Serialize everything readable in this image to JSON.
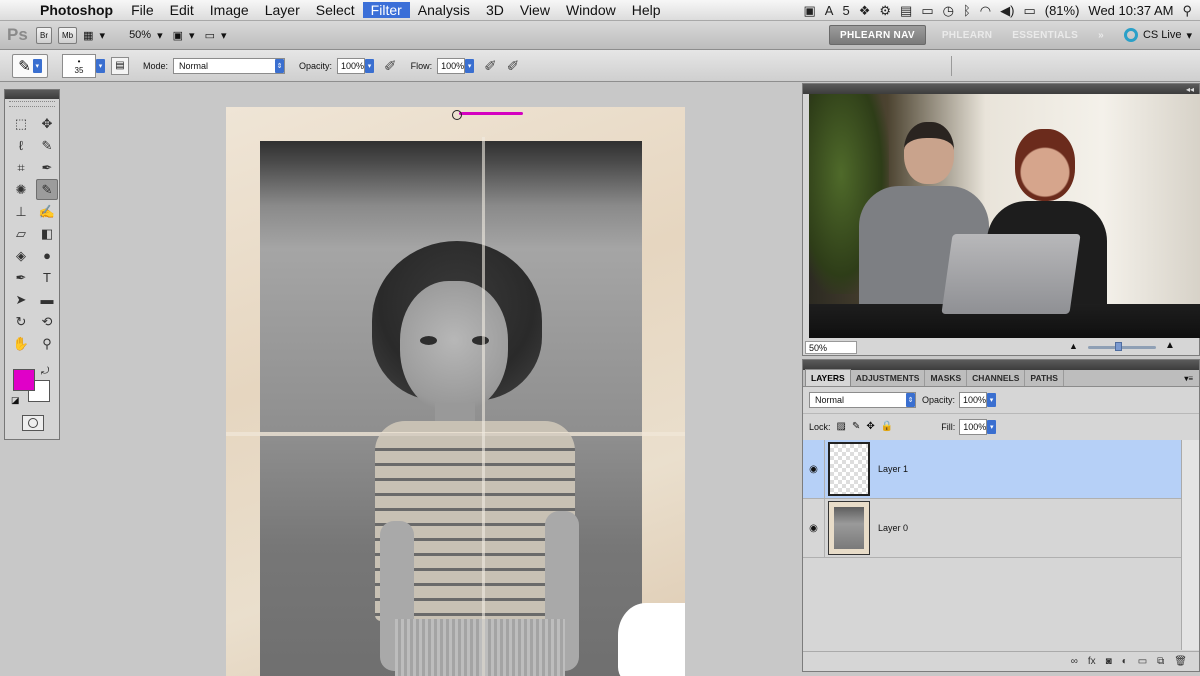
{
  "menubar": {
    "app_name": "Photoshop",
    "items": [
      "File",
      "Edit",
      "Image",
      "Layer",
      "Select",
      "Filter",
      "Analysis",
      "3D",
      "View",
      "Window",
      "Help"
    ],
    "active_item": "Filter",
    "status": {
      "adobe_count": "5",
      "battery": "(81%)",
      "clock": "Wed 10:37 AM"
    }
  },
  "appbar": {
    "logo": "Ps",
    "bridge": "Br",
    "mini_bridge": "Mb",
    "zoom": "50%",
    "workspaces": [
      "PHLEARN NAV",
      "PHLEARN",
      "ESSENTIALS"
    ],
    "active_workspace": "PHLEARN NAV",
    "cs_live": "CS Live"
  },
  "options": {
    "brush_size": "35",
    "mode_label": "Mode:",
    "mode_value": "Normal",
    "opacity_label": "Opacity:",
    "opacity_value": "100%",
    "flow_label": "Flow:",
    "flow_value": "100%"
  },
  "colors": {
    "foreground": "#e000c8",
    "background": "#ffffff",
    "selection": "#b6d0f7",
    "accent": "#3b6fd8"
  },
  "navigator": {
    "zoom": "50%"
  },
  "layers": {
    "tabs": [
      "LAYERS",
      "ADJUSTMENTS",
      "MASKS",
      "CHANNELS",
      "PATHS"
    ],
    "active_tab": "LAYERS",
    "blend_mode": "Normal",
    "opacity_label": "Opacity:",
    "opacity_value": "100%",
    "lock_label": "Lock:",
    "fill_label": "Fill:",
    "fill_value": "100%",
    "items": [
      {
        "name": "Layer 1",
        "selected": true,
        "visible": true
      },
      {
        "name": "Layer 0",
        "selected": false,
        "visible": true
      }
    ]
  }
}
